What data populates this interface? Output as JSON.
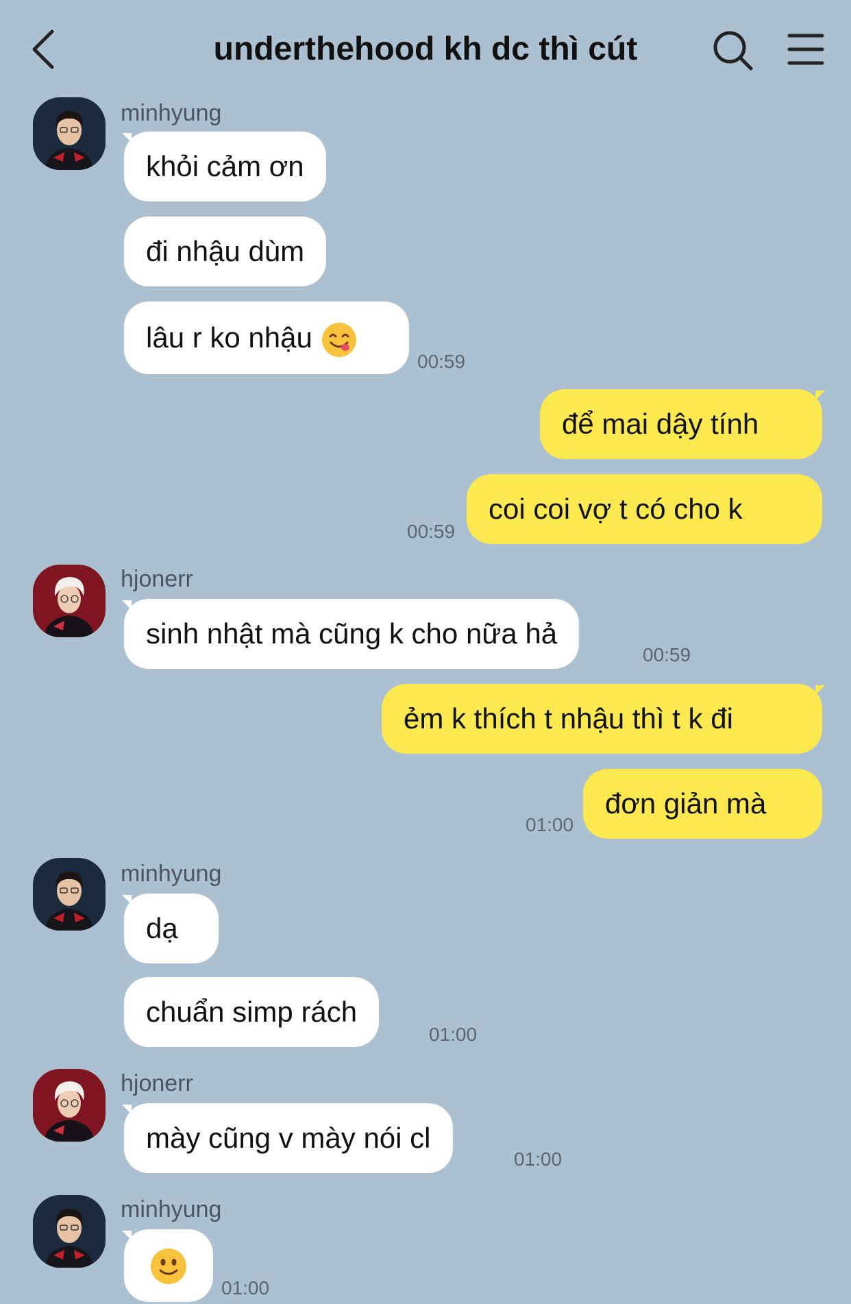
{
  "header": {
    "title": "underthehood kh dc thì cút"
  },
  "messages": {
    "m1_sender": "minhyung",
    "m1_b1": "khỏi cảm ơn",
    "m1_b2": "đi nhậu dùm",
    "m1_b3": "lâu r ko nhậu",
    "m1_time": "00:59",
    "o1_b1": "để mai dậy tính",
    "o1_b2": "coi coi vợ t có cho k",
    "o1_time": "00:59",
    "m2_sender": "hjonerr",
    "m2_b1": "sinh nhật mà cũng k cho nữa hả",
    "m2_time": "00:59",
    "o2_b1": "ẻm k thích t nhậu thì t k đi",
    "o2_b2": "đơn giản mà",
    "o2_time": "01:00",
    "m3_sender": "minhyung",
    "m3_b1": "dạ",
    "m3_b2": "chuẩn simp rách",
    "m3_time": "01:00",
    "m4_sender": "hjonerr",
    "m4_b1": "mày cũng v mày nói cl",
    "m4_time": "01:00",
    "m5_sender": "minhyung",
    "m5_time": "01:00"
  },
  "icons": {
    "back": "chevron-left-icon",
    "search": "search-icon",
    "menu": "hamburger-menu-icon",
    "emoji_yum": "face-savoring-food-emoji",
    "emoji_smile": "slightly-smiling-face-emoji"
  },
  "colors": {
    "background": "#abc1d1",
    "incoming_bubble": "#ffffff",
    "outgoing_bubble": "#fbe94f"
  }
}
